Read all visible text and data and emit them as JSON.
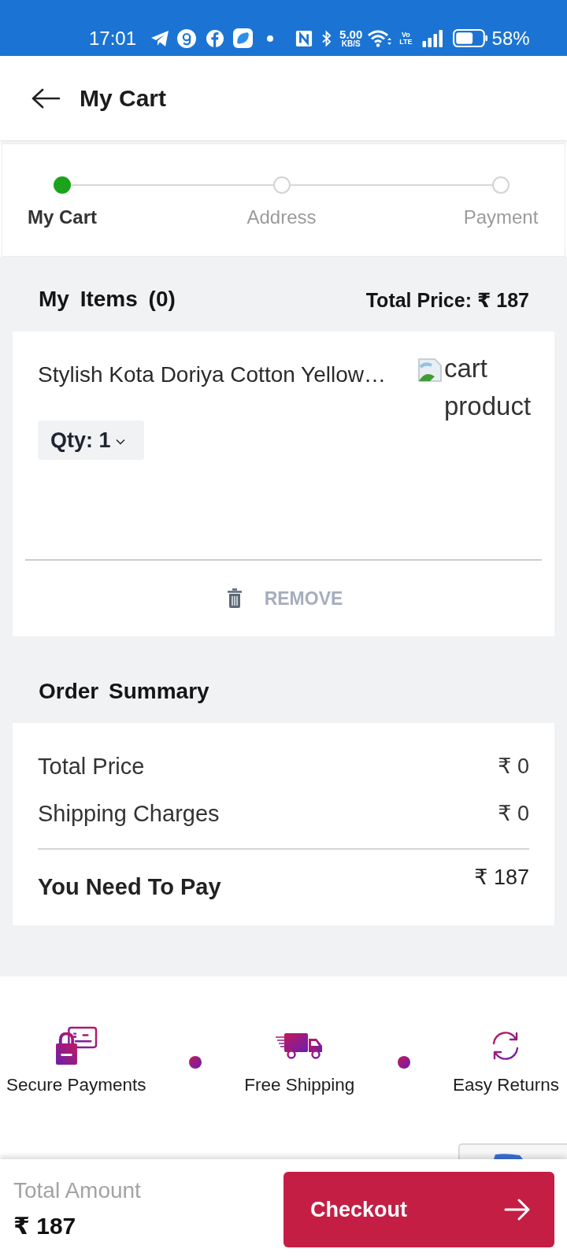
{
  "status_bar": {
    "time": "17:01",
    "speed_value": "5.00",
    "speed_unit": "KB/S",
    "volte_top": "Vo",
    "volte_bottom": "LTE",
    "battery": "58%"
  },
  "header": {
    "title": "My Cart"
  },
  "stepper": {
    "steps": [
      {
        "label": "My Cart",
        "selected": true
      },
      {
        "label": "Address",
        "selected": false
      },
      {
        "label": "Payment",
        "selected": false
      }
    ]
  },
  "items_header": {
    "title": "My Items (0)",
    "total_price": "Total Price: ₹ 187"
  },
  "cart_items": [
    {
      "title": "Stylish Kota Doriya Cotton Yellow…",
      "quantity": "Qty: 1",
      "image_alt": "cart product",
      "remove_label": "REMOVE"
    }
  ],
  "order_summary": {
    "title": "Order Summary",
    "rows": [
      {
        "label": "Total Price",
        "value": "₹ 0"
      },
      {
        "label": "Shipping Charges",
        "value": "₹ 0"
      }
    ],
    "total": {
      "label": "You Need To Pay",
      "value": "₹ 187"
    }
  },
  "trust_badges": [
    {
      "kind": "card-lock",
      "label": "Secure Payments"
    },
    {
      "kind": "truck",
      "label": "Free Shipping"
    },
    {
      "kind": "refresh",
      "label": "Easy Returns"
    }
  ],
  "bottom_bar": {
    "total_label": "Total Amount",
    "total_value": "₹ 187",
    "checkout_label": "Checkout"
  }
}
